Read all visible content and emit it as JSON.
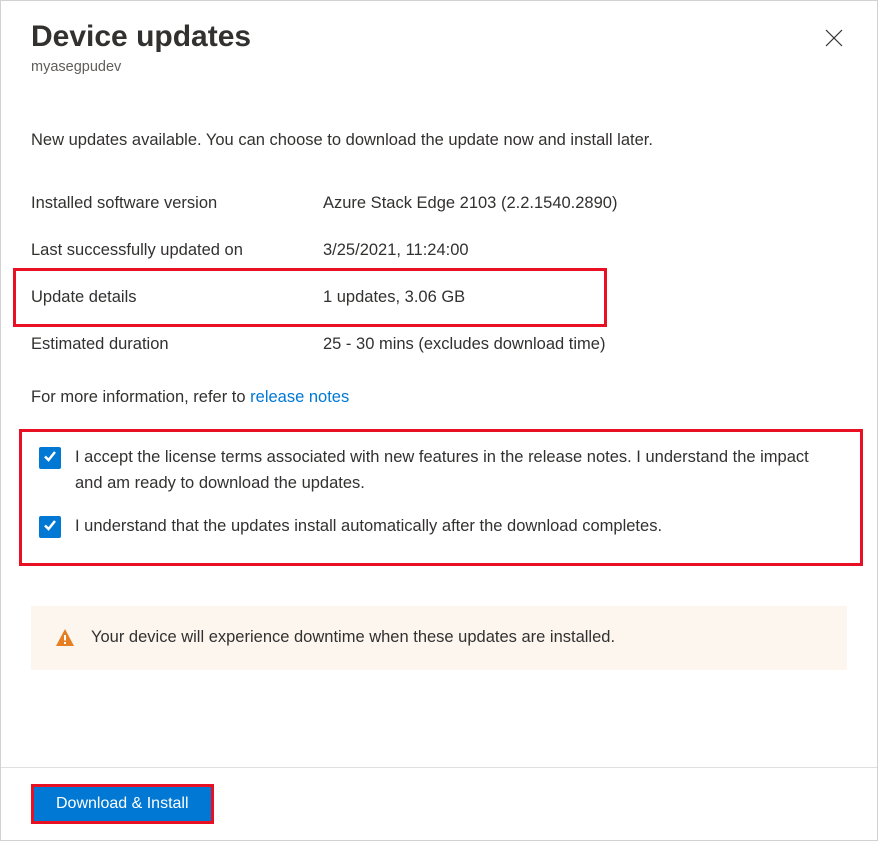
{
  "header": {
    "title": "Device updates",
    "subtitle": "myasegpudev"
  },
  "status_text": "New updates available. You can choose to download the update now and install later.",
  "info": {
    "version_label": "Installed software version",
    "version_value": "Azure Stack Edge 2103 (2.2.1540.2890)",
    "last_updated_label": "Last successfully updated on",
    "last_updated_value": "3/25/2021, 11:24:00",
    "update_details_label": "Update details",
    "update_details_value": "1 updates, 3.06 GB",
    "estimated_label": "Estimated duration",
    "estimated_value": "25 - 30 mins (excludes download time)"
  },
  "more_info": {
    "prefix": "For more information, refer to ",
    "link_text": "release notes"
  },
  "checkboxes": {
    "accept_label": "I accept the license terms associated with new features in the release notes. I understand the impact and am ready to download the updates.",
    "auto_install_label": "I understand that the updates install automatically after the download completes."
  },
  "warning": {
    "text": "Your device will experience downtime when these updates are installed."
  },
  "footer": {
    "download_install_label": "Download & Install"
  }
}
